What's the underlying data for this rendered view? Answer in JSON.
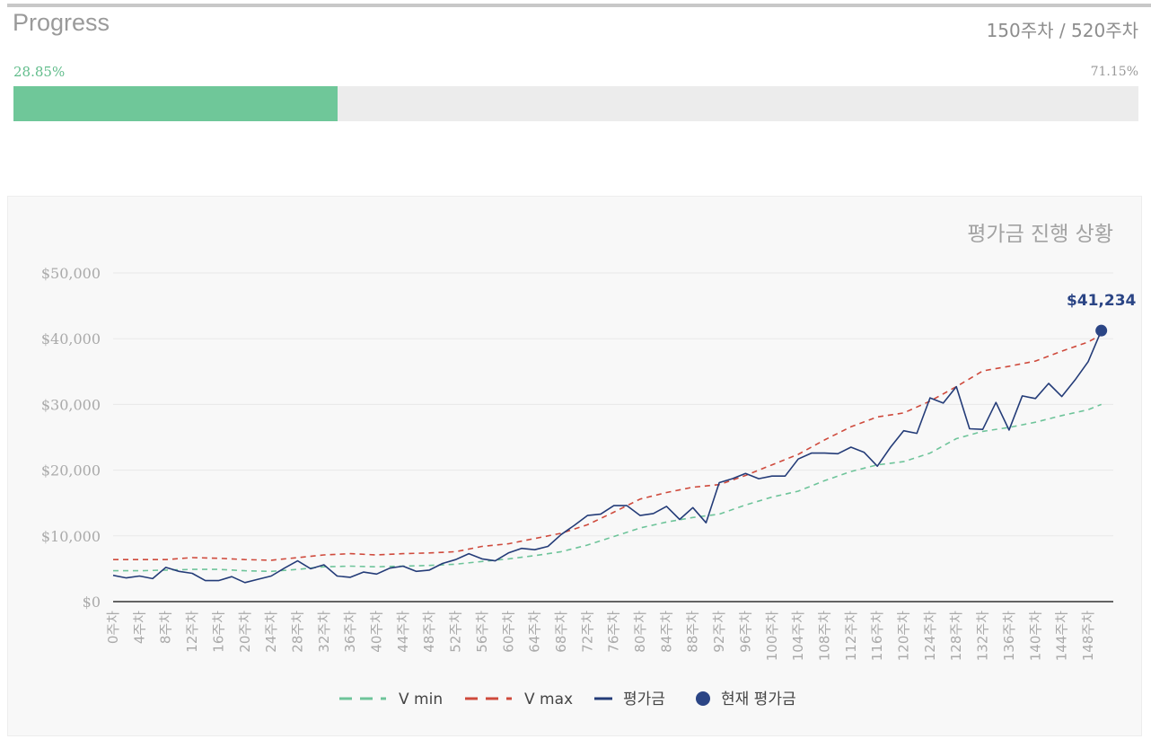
{
  "progress": {
    "title": "Progress",
    "current_week": "150주차",
    "separator": " / ",
    "total_weeks": "520주차",
    "completed_pct_label": "28.85%",
    "remaining_pct_label": "71.15%",
    "completed_fraction": 0.2885
  },
  "colors": {
    "vmin": "#6ec49a",
    "vmax": "#cf4a3c",
    "avg": "#243c78",
    "current": "#2b4585",
    "progress_fill": "#6fc799",
    "axis_text": "#aaaaaa"
  },
  "chart_data": {
    "type": "line",
    "title": "평가금 진행 상황",
    "ylim": [
      0,
      50000
    ],
    "yticks": [
      0,
      10000,
      20000,
      30000,
      40000,
      50000
    ],
    "ytick_labels": [
      "$0",
      "$10,000",
      "$20,000",
      "$30,000",
      "$40,000",
      "$50,000"
    ],
    "xlim": [
      0,
      151
    ],
    "xtick_values": [
      0,
      4,
      8,
      12,
      16,
      20,
      24,
      28,
      32,
      36,
      40,
      44,
      48,
      52,
      56,
      60,
      64,
      68,
      72,
      76,
      80,
      84,
      88,
      92,
      96,
      100,
      104,
      108,
      112,
      116,
      120,
      124,
      128,
      132,
      136,
      140,
      144,
      148
    ],
    "xtick_labels": [
      "0주차",
      "4주차",
      "8주차",
      "12주차",
      "16주차",
      "20주차",
      "24주차",
      "28주차",
      "32주차",
      "36주차",
      "40주차",
      "44주차",
      "48주차",
      "52주차",
      "56주차",
      "60주차",
      "64주차",
      "68주차",
      "72주차",
      "76주차",
      "80주차",
      "84주차",
      "88주차",
      "92주차",
      "96주차",
      "100주차",
      "104주차",
      "108주차",
      "112주차",
      "116주차",
      "120주차",
      "124주차",
      "128주차",
      "132주차",
      "136주차",
      "140주차",
      "144주차",
      "148주차"
    ],
    "grid": "horizontal",
    "legend_position": "bottom",
    "series": [
      {
        "name": "V min",
        "style": "dashed",
        "x": [
          0,
          4,
          8,
          12,
          16,
          20,
          24,
          28,
          32,
          36,
          40,
          44,
          48,
          52,
          56,
          60,
          64,
          68,
          72,
          76,
          80,
          84,
          88,
          92,
          96,
          100,
          104,
          108,
          112,
          116,
          120,
          124,
          128,
          132,
          136,
          140,
          144,
          148,
          150
        ],
        "values": [
          4700,
          4700,
          4800,
          4900,
          4900,
          4700,
          4600,
          4900,
          5300,
          5400,
          5300,
          5400,
          5500,
          5700,
          6100,
          6500,
          7000,
          7600,
          8600,
          9900,
          11200,
          12100,
          12800,
          13300,
          14700,
          15900,
          16800,
          18400,
          19800,
          20800,
          21300,
          22600,
          24800,
          25900,
          26500,
          27300,
          28300,
          29200,
          30000
        ]
      },
      {
        "name": "V max",
        "style": "dashed",
        "x": [
          0,
          4,
          8,
          12,
          16,
          20,
          24,
          28,
          32,
          36,
          40,
          44,
          48,
          52,
          56,
          60,
          64,
          68,
          72,
          76,
          80,
          84,
          88,
          92,
          96,
          100,
          104,
          108,
          112,
          116,
          120,
          124,
          128,
          132,
          136,
          140,
          144,
          148,
          150
        ],
        "values": [
          6400,
          6400,
          6400,
          6700,
          6600,
          6400,
          6300,
          6700,
          7100,
          7300,
          7100,
          7300,
          7400,
          7600,
          8400,
          8800,
          9600,
          10400,
          11700,
          13600,
          15600,
          16600,
          17400,
          17800,
          19200,
          20800,
          22400,
          24600,
          26600,
          28100,
          28700,
          30500,
          32700,
          35100,
          35800,
          36600,
          38100,
          39500,
          40600
        ]
      },
      {
        "name": "평가금",
        "style": "solid",
        "x": [
          0,
          2,
          4,
          6,
          8,
          10,
          12,
          14,
          16,
          18,
          20,
          22,
          24,
          26,
          28,
          30,
          32,
          34,
          36,
          38,
          40,
          42,
          44,
          46,
          48,
          50,
          52,
          54,
          56,
          58,
          60,
          62,
          64,
          66,
          68,
          70,
          72,
          74,
          76,
          78,
          80,
          82,
          84,
          86,
          88,
          90,
          92,
          94,
          96,
          98,
          100,
          102,
          104,
          106,
          108,
          110,
          112,
          114,
          116,
          118,
          120,
          122,
          124,
          126,
          128,
          130,
          132,
          134,
          136,
          138,
          140,
          142,
          144,
          146,
          148,
          150
        ],
        "values": [
          4000,
          3600,
          3900,
          3500,
          5200,
          4600,
          4300,
          3200,
          3200,
          3800,
          2900,
          3400,
          3900,
          5100,
          6200,
          5000,
          5600,
          3900,
          3700,
          4500,
          4200,
          5100,
          5400,
          4600,
          4800,
          5800,
          6400,
          7300,
          6500,
          6200,
          7400,
          8100,
          7900,
          8400,
          10200,
          11600,
          13100,
          13300,
          14600,
          14600,
          13100,
          13400,
          14500,
          12500,
          14300,
          12000,
          18100,
          18700,
          19500,
          18700,
          19100,
          19100,
          21700,
          22600,
          22600,
          22500,
          23500,
          22700,
          20600,
          23500,
          26000,
          25600,
          31000,
          30200,
          32700,
          26300,
          26200,
          30300,
          26100,
          31300,
          30900,
          33200,
          31200,
          33700,
          36500,
          41234
        ]
      }
    ],
    "current": {
      "name": "현재 평가금",
      "x": 150,
      "value": 41234,
      "label": "$41,234"
    },
    "legend": [
      "V min",
      "V max",
      "평가금",
      "현재 평가금"
    ]
  }
}
